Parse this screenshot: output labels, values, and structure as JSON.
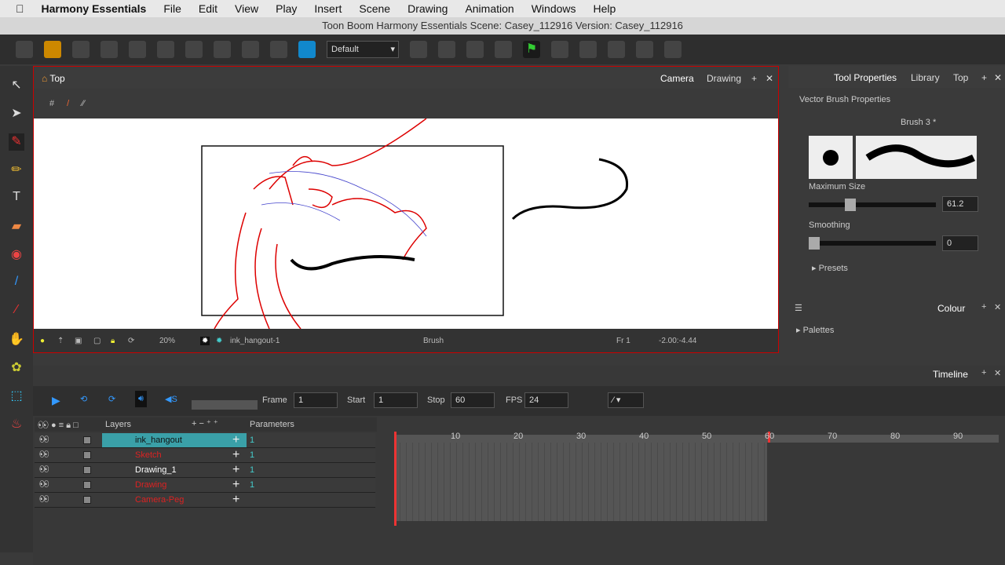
{
  "menubar": {
    "app": "Harmony Essentials",
    "items": [
      "File",
      "Edit",
      "View",
      "Play",
      "Insert",
      "Scene",
      "Drawing",
      "Animation",
      "Windows",
      "Help"
    ]
  },
  "titlebar": {
    "title": "Toon Boom Harmony Essentials Scene: Casey_112916 Version: Casey_112916"
  },
  "toolbar": {
    "workspace": "Default"
  },
  "view": {
    "title": "Top",
    "tabs": [
      "Camera",
      "Drawing"
    ],
    "status": {
      "zoom": "20%",
      "drawing": "ink_hangout-1",
      "tool": "Brush",
      "frame": "Fr 1",
      "coords": "-2.00:-4.44"
    }
  },
  "tool_properties": {
    "tabs": [
      "Tool Properties",
      "Library",
      "Top"
    ],
    "section": "Vector Brush Properties",
    "brush": "Brush 3 *",
    "max_size_label": "Maximum Size",
    "max_size": "61.2",
    "smoothing_label": "Smoothing",
    "smoothing": "0",
    "presets": "Presets"
  },
  "colour": {
    "title": "Colour",
    "palettes": "Palettes"
  },
  "timeline": {
    "title": "Timeline",
    "frame_label": "Frame",
    "frame": "1",
    "start_label": "Start",
    "start": "1",
    "stop_label": "Stop",
    "stop": "60",
    "fps_label": "FPS",
    "fps": "24",
    "layers_header": "Layers",
    "params_header": "Parameters",
    "layers": [
      {
        "name": "ink_hangout",
        "param": "1",
        "color": "#111111"
      },
      {
        "name": "Sketch",
        "param": "1",
        "color": "#dd2222"
      },
      {
        "name": "Drawing_1",
        "param": "1",
        "color": "#ffffff"
      },
      {
        "name": "Drawing",
        "param": "1",
        "color": "#dd2222"
      },
      {
        "name": "Camera-Peg",
        "param": "",
        "color": "#dd2222"
      }
    ],
    "ruler": [
      "10",
      "20",
      "30",
      "40",
      "50",
      "60",
      "70",
      "80",
      "90"
    ]
  },
  "colors": {
    "accent": "#3aa0a8",
    "selection": "#cc0000"
  }
}
